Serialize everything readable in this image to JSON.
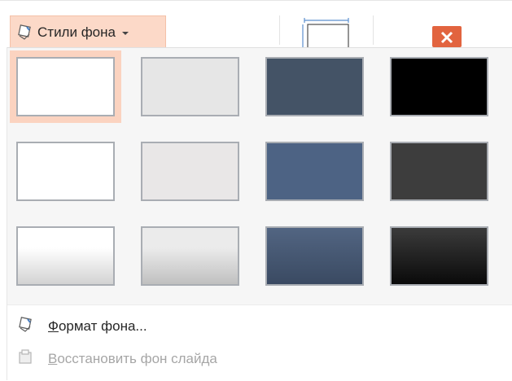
{
  "ribbon": {
    "styles_button": {
      "label": "Стили фона",
      "icon": "paint-bucket-icon"
    },
    "slide_size_icon": "slide-size-icon",
    "close_icon": "close-icon"
  },
  "colors": {
    "accent_highlight": "#fcd9c8",
    "close_button": "#e2643f",
    "gallery_bg": "#f6f6f6"
  },
  "gallery": {
    "rows": [
      [
        {
          "name": "style-1",
          "fill": "#ffffff",
          "selected": true
        },
        {
          "name": "style-2",
          "fill": "#e6e6e6"
        },
        {
          "name": "style-3",
          "fill": "#445366"
        },
        {
          "name": "style-4",
          "fill": "#000000"
        }
      ],
      [
        {
          "name": "style-5",
          "fill": "#ffffff"
        },
        {
          "name": "style-6",
          "fill": "#e9e7e7"
        },
        {
          "name": "style-7",
          "fill": "#4d6384"
        },
        {
          "name": "style-8",
          "fill": "#3d3d3d"
        }
      ],
      [
        {
          "name": "style-9",
          "fill": "linear-gradient(#ffffff 35%, #d3d3d3)"
        },
        {
          "name": "style-10",
          "fill": "linear-gradient(#ebebeb 35%, #c0c0c0)"
        },
        {
          "name": "style-11",
          "fill": "linear-gradient(#526582, #3a4a62)"
        },
        {
          "name": "style-12",
          "fill": "linear-gradient(#3b3b3b, #0a0a0a)"
        }
      ]
    ]
  },
  "menu": {
    "format_background": {
      "label": "Формат фона...",
      "icon": "format-background-icon"
    },
    "reset_background": {
      "label": "Восстановить фон слайда",
      "icon": "reset-background-icon",
      "disabled": true
    }
  }
}
